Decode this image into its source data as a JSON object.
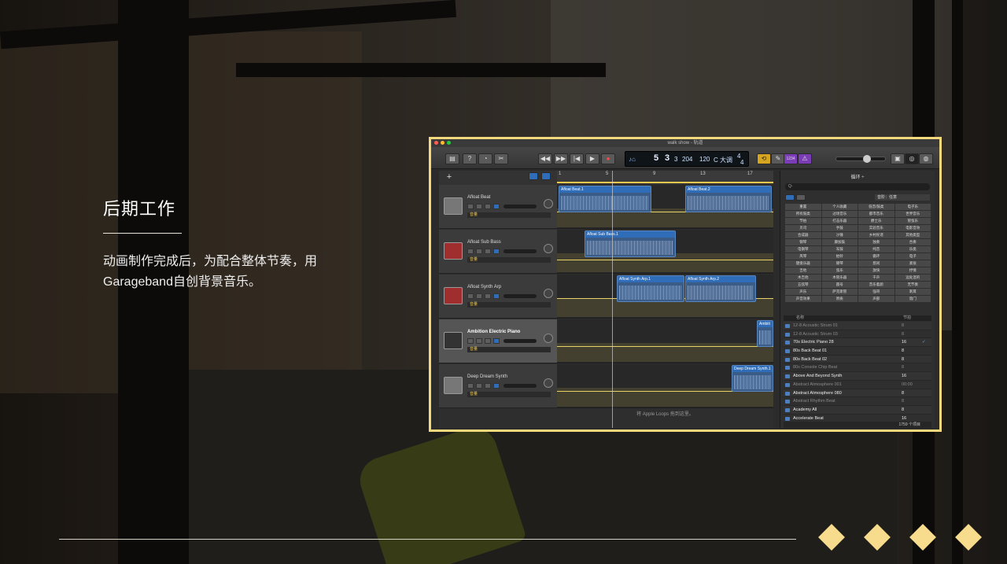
{
  "slide": {
    "title": "后期工作",
    "description": "动画制作完成后，为配合整体节奏，用Garageband自创背景音乐。"
  },
  "garageband": {
    "window_title": "walk show - 轨道",
    "lcd": {
      "bar": "5",
      "beat": "3",
      "division": "3",
      "tick": "204",
      "tempo": "120",
      "key": "C 大调",
      "time_sig_top": "4",
      "time_sig_bottom": "4"
    },
    "count_in": "1234",
    "ruler_marks": [
      "1",
      "5",
      "9",
      "13",
      "17"
    ],
    "tracks": [
      {
        "name": "Afloat Beat",
        "volume_menu": "音量",
        "regions": [
          "Afloat Beat.1",
          "Afloat Beat.2"
        ]
      },
      {
        "name": "Afloat Sub Bass",
        "volume_menu": "音量",
        "regions": [
          "Afloat Sub Bass.1"
        ]
      },
      {
        "name": "Afloat Synth Arp",
        "volume_menu": "音量",
        "regions": [
          "Afloat Synth Arp.1",
          "Afloat Synth Arp.2"
        ]
      },
      {
        "name": "Ambition Electric Piano",
        "volume_menu": "音量",
        "regions": [
          "Ambiti"
        ]
      },
      {
        "name": "Deep Dream Synth",
        "volume_menu": "音量",
        "regions": [
          "Deep Dream Synth.1"
        ]
      }
    ],
    "drop_hint": "将 Apple Loops 拖到这里。",
    "loops": {
      "title": "循环 ÷",
      "search_placeholder": "Q-",
      "scale_label": "音阶：任意",
      "keywords": [
        "重置",
        "个人收藏",
        "低音/鼓类",
        "电子乐",
        "所有鼓类",
        "过场音乐",
        "都市音乐",
        "世界音乐",
        "节拍",
        "打击乐器",
        "爵士乐",
        "管弦乐",
        "贝司",
        "手鼓",
        "实验音乐",
        "电影音效",
        "合成器",
        "沙锤",
        "乡村民谣",
        "其他类型",
        "钢琴",
        "康加鼓",
        "独奏",
        "合奏",
        "电钢琴",
        "军鼓",
        "纯音",
        "乐类",
        "风琴",
        "拍铃",
        "循环",
        "电子",
        "键盘乐器",
        "镲琴",
        "悠闲",
        "紧张",
        "吉他",
        "弦乐",
        "放快",
        "抒情",
        "木吉他",
        "木管乐器",
        "干声",
        "远处混的",
        "五弦琴",
        "圆号",
        "音乐着颜",
        "无节奏",
        "声乐",
        "萨克斯管",
        "强哥",
        "刺耳",
        "声音效果",
        "原质",
        "声部",
        "谐门"
      ],
      "col_name": "名称",
      "col_beats": "节拍",
      "rows": [
        {
          "name": "12-8 Acoustic Strum 01",
          "beats": "8",
          "dim": true
        },
        {
          "name": "12-8 Acoustic Strum 03",
          "beats": "8",
          "dim": true
        },
        {
          "name": "70s Electric Piano 28",
          "beats": "16",
          "dim": false,
          "fav": "✓"
        },
        {
          "name": "80s Back Beat 01",
          "beats": "8",
          "dim": false
        },
        {
          "name": "80s Back Beat 02",
          "beats": "8",
          "dim": false
        },
        {
          "name": "80s Console Chip Beat",
          "beats": "8",
          "dim": true
        },
        {
          "name": "Above And Beyond Synth",
          "beats": "16",
          "dim": false
        },
        {
          "name": "Abstract Atmosphere 001",
          "beats": "00:00",
          "dim": true
        },
        {
          "name": "Abstract Atmosphere 080",
          "beats": "8",
          "dim": false
        },
        {
          "name": "Abstract Rhythm Beat",
          "beats": "8",
          "dim": true
        },
        {
          "name": "Academy All",
          "beats": "8",
          "dim": false
        },
        {
          "name": "Accelerate Beat",
          "beats": "16",
          "dim": false
        }
      ],
      "item_count": "1759 个项目"
    }
  },
  "colors": {
    "accent": "#f6dc8c",
    "frame": "#f3d97c",
    "region": "#3b5c86"
  }
}
